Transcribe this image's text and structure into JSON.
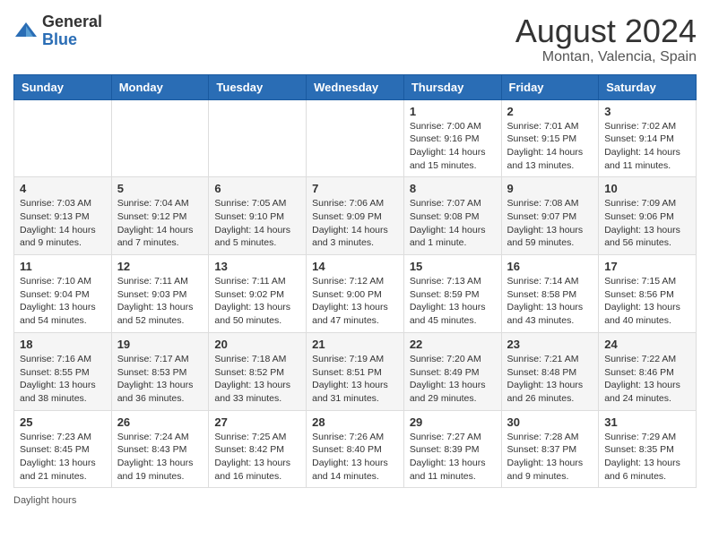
{
  "header": {
    "logo_general": "General",
    "logo_blue": "Blue",
    "month_year": "August 2024",
    "location": "Montan, Valencia, Spain"
  },
  "days_of_week": [
    "Sunday",
    "Monday",
    "Tuesday",
    "Wednesday",
    "Thursday",
    "Friday",
    "Saturday"
  ],
  "weeks": [
    {
      "cells": [
        {
          "day": "",
          "info": ""
        },
        {
          "day": "",
          "info": ""
        },
        {
          "day": "",
          "info": ""
        },
        {
          "day": "",
          "info": ""
        },
        {
          "day": "1",
          "info": "Sunrise: 7:00 AM\nSunset: 9:16 PM\nDaylight: 14 hours and 15 minutes."
        },
        {
          "day": "2",
          "info": "Sunrise: 7:01 AM\nSunset: 9:15 PM\nDaylight: 14 hours and 13 minutes."
        },
        {
          "day": "3",
          "info": "Sunrise: 7:02 AM\nSunset: 9:14 PM\nDaylight: 14 hours and 11 minutes."
        }
      ]
    },
    {
      "cells": [
        {
          "day": "4",
          "info": "Sunrise: 7:03 AM\nSunset: 9:13 PM\nDaylight: 14 hours and 9 minutes."
        },
        {
          "day": "5",
          "info": "Sunrise: 7:04 AM\nSunset: 9:12 PM\nDaylight: 14 hours and 7 minutes."
        },
        {
          "day": "6",
          "info": "Sunrise: 7:05 AM\nSunset: 9:10 PM\nDaylight: 14 hours and 5 minutes."
        },
        {
          "day": "7",
          "info": "Sunrise: 7:06 AM\nSunset: 9:09 PM\nDaylight: 14 hours and 3 minutes."
        },
        {
          "day": "8",
          "info": "Sunrise: 7:07 AM\nSunset: 9:08 PM\nDaylight: 14 hours and 1 minute."
        },
        {
          "day": "9",
          "info": "Sunrise: 7:08 AM\nSunset: 9:07 PM\nDaylight: 13 hours and 59 minutes."
        },
        {
          "day": "10",
          "info": "Sunrise: 7:09 AM\nSunset: 9:06 PM\nDaylight: 13 hours and 56 minutes."
        }
      ]
    },
    {
      "cells": [
        {
          "day": "11",
          "info": "Sunrise: 7:10 AM\nSunset: 9:04 PM\nDaylight: 13 hours and 54 minutes."
        },
        {
          "day": "12",
          "info": "Sunrise: 7:11 AM\nSunset: 9:03 PM\nDaylight: 13 hours and 52 minutes."
        },
        {
          "day": "13",
          "info": "Sunrise: 7:11 AM\nSunset: 9:02 PM\nDaylight: 13 hours and 50 minutes."
        },
        {
          "day": "14",
          "info": "Sunrise: 7:12 AM\nSunset: 9:00 PM\nDaylight: 13 hours and 47 minutes."
        },
        {
          "day": "15",
          "info": "Sunrise: 7:13 AM\nSunset: 8:59 PM\nDaylight: 13 hours and 45 minutes."
        },
        {
          "day": "16",
          "info": "Sunrise: 7:14 AM\nSunset: 8:58 PM\nDaylight: 13 hours and 43 minutes."
        },
        {
          "day": "17",
          "info": "Sunrise: 7:15 AM\nSunset: 8:56 PM\nDaylight: 13 hours and 40 minutes."
        }
      ]
    },
    {
      "cells": [
        {
          "day": "18",
          "info": "Sunrise: 7:16 AM\nSunset: 8:55 PM\nDaylight: 13 hours and 38 minutes."
        },
        {
          "day": "19",
          "info": "Sunrise: 7:17 AM\nSunset: 8:53 PM\nDaylight: 13 hours and 36 minutes."
        },
        {
          "day": "20",
          "info": "Sunrise: 7:18 AM\nSunset: 8:52 PM\nDaylight: 13 hours and 33 minutes."
        },
        {
          "day": "21",
          "info": "Sunrise: 7:19 AM\nSunset: 8:51 PM\nDaylight: 13 hours and 31 minutes."
        },
        {
          "day": "22",
          "info": "Sunrise: 7:20 AM\nSunset: 8:49 PM\nDaylight: 13 hours and 29 minutes."
        },
        {
          "day": "23",
          "info": "Sunrise: 7:21 AM\nSunset: 8:48 PM\nDaylight: 13 hours and 26 minutes."
        },
        {
          "day": "24",
          "info": "Sunrise: 7:22 AM\nSunset: 8:46 PM\nDaylight: 13 hours and 24 minutes."
        }
      ]
    },
    {
      "cells": [
        {
          "day": "25",
          "info": "Sunrise: 7:23 AM\nSunset: 8:45 PM\nDaylight: 13 hours and 21 minutes."
        },
        {
          "day": "26",
          "info": "Sunrise: 7:24 AM\nSunset: 8:43 PM\nDaylight: 13 hours and 19 minutes."
        },
        {
          "day": "27",
          "info": "Sunrise: 7:25 AM\nSunset: 8:42 PM\nDaylight: 13 hours and 16 minutes."
        },
        {
          "day": "28",
          "info": "Sunrise: 7:26 AM\nSunset: 8:40 PM\nDaylight: 13 hours and 14 minutes."
        },
        {
          "day": "29",
          "info": "Sunrise: 7:27 AM\nSunset: 8:39 PM\nDaylight: 13 hours and 11 minutes."
        },
        {
          "day": "30",
          "info": "Sunrise: 7:28 AM\nSunset: 8:37 PM\nDaylight: 13 hours and 9 minutes."
        },
        {
          "day": "31",
          "info": "Sunrise: 7:29 AM\nSunset: 8:35 PM\nDaylight: 13 hours and 6 minutes."
        }
      ]
    }
  ],
  "footer": {
    "daylight_label": "Daylight hours"
  }
}
